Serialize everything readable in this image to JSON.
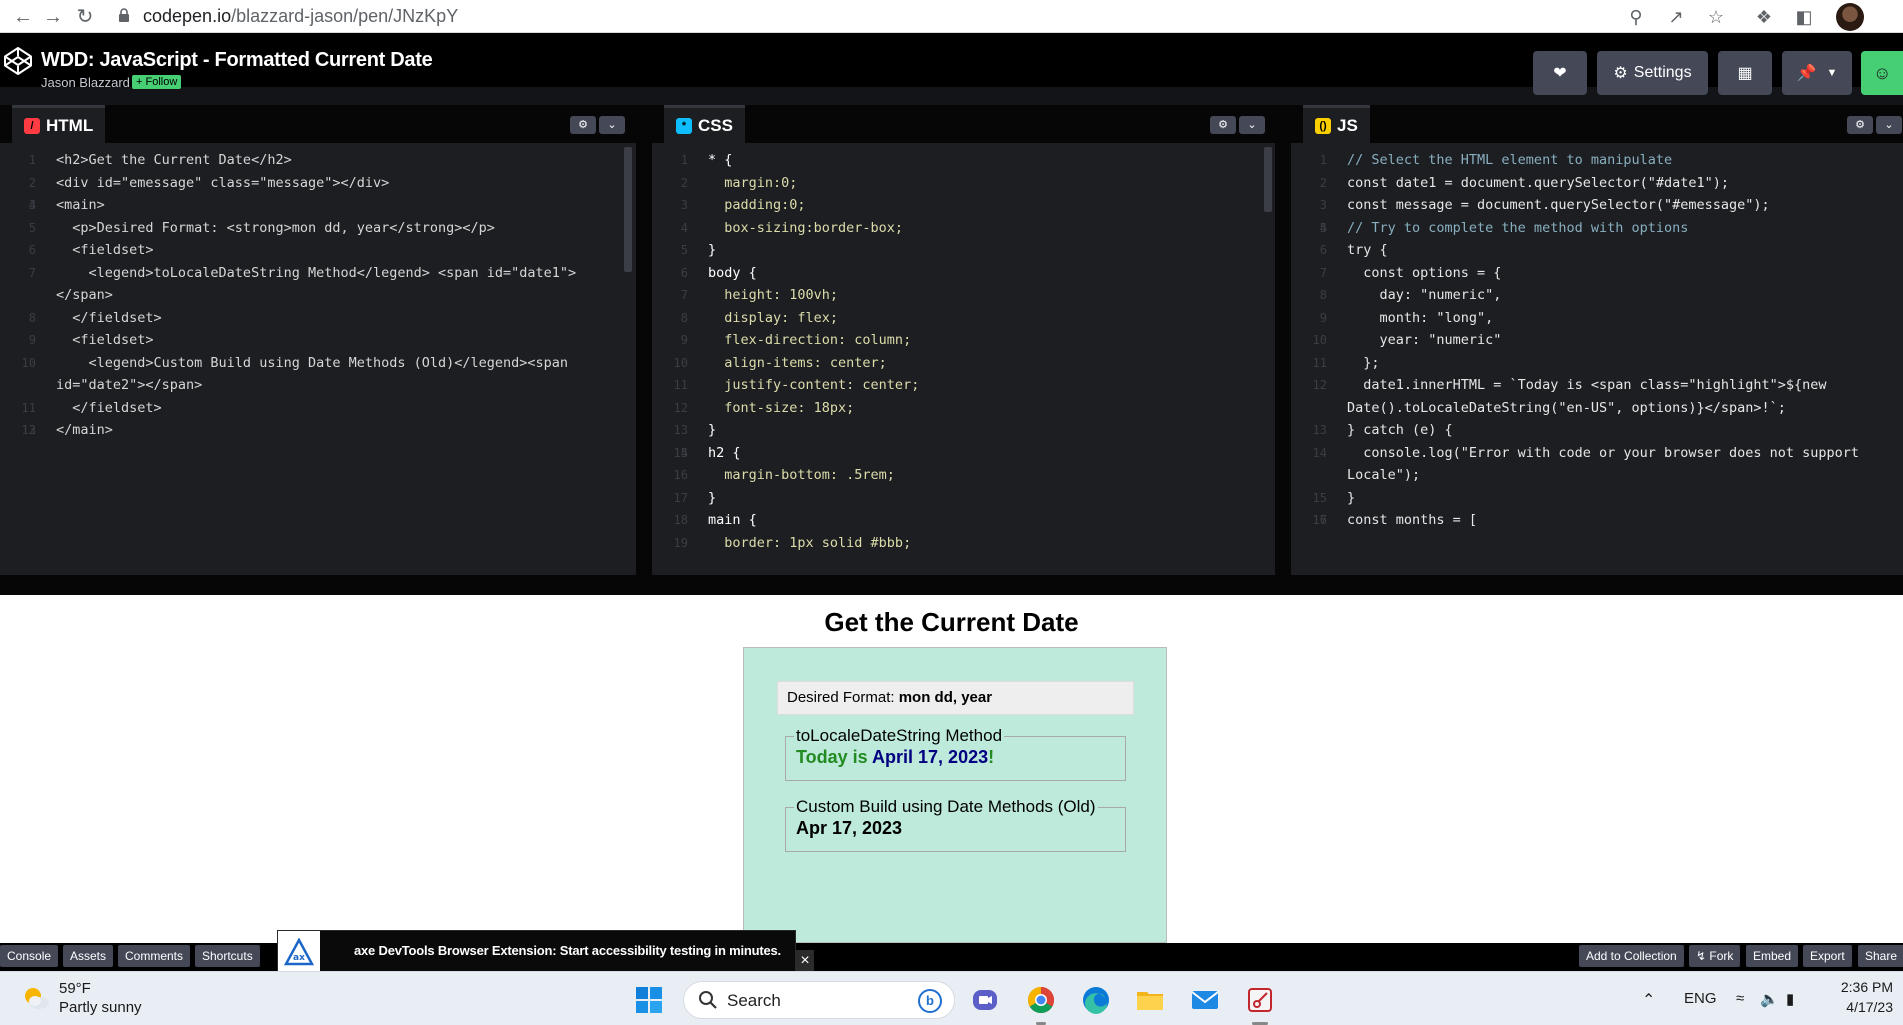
{
  "browser": {
    "url_host": "codepen.io",
    "url_path": "/blazzard-jason/pen/JNzKpY"
  },
  "pen": {
    "title": "WDD: JavaScript - Formatted Current Date",
    "author": "Jason Blazzard",
    "follow_label": "+ Follow",
    "settings_label": "Settings"
  },
  "editors": {
    "html": {
      "label": "HTML",
      "badge_color": "#ff3c41"
    },
    "css": {
      "label": "CSS",
      "badge_color": "#0ebeff"
    },
    "js": {
      "label": "JS",
      "badge_color": "#fcd000"
    }
  },
  "html_code": [
    {
      "n": "1",
      "t": "<h2>Get the Current Date</h2>"
    },
    {
      "n": "2",
      "t": "<div id=\"emessage\" class=\"message\"></div>"
    },
    {
      "n": "3",
      "t": ""
    },
    {
      "n": "4",
      "t": "<main>"
    },
    {
      "n": "5",
      "t": "  <p>Desired Format: <strong>mon dd, year</strong></p>"
    },
    {
      "n": "6",
      "t": "  <fieldset>"
    },
    {
      "n": "7",
      "t": "    <legend>toLocaleDateString Method</legend> <span id=\"date1\">"
    },
    {
      "n": "",
      "t": "</span>"
    },
    {
      "n": "8",
      "t": "  </fieldset>"
    },
    {
      "n": "9",
      "t": "  <fieldset>"
    },
    {
      "n": "10",
      "t": "    <legend>Custom Build using Date Methods (Old)</legend><span"
    },
    {
      "n": "",
      "t": "id=\"date2\"></span>"
    },
    {
      "n": "11",
      "t": "  </fieldset>"
    },
    {
      "n": "12",
      "t": ""
    },
    {
      "n": "13",
      "t": "</main>"
    }
  ],
  "css_code": [
    {
      "n": "1",
      "t": "* {"
    },
    {
      "n": "2",
      "t": "  margin:0;"
    },
    {
      "n": "3",
      "t": "  padding:0;"
    },
    {
      "n": "4",
      "t": "  box-sizing:border-box;"
    },
    {
      "n": "5",
      "t": "}"
    },
    {
      "n": "6",
      "t": "body {"
    },
    {
      "n": "7",
      "t": "  height: 100vh;"
    },
    {
      "n": "8",
      "t": "  display: flex;"
    },
    {
      "n": "9",
      "t": "  flex-direction: column;"
    },
    {
      "n": "10",
      "t": "  align-items: center;"
    },
    {
      "n": "11",
      "t": "  justify-content: center;"
    },
    {
      "n": "12",
      "t": "  font-size: 18px;"
    },
    {
      "n": "13",
      "t": "}"
    },
    {
      "n": "14",
      "t": ""
    },
    {
      "n": "15",
      "t": "h2 {"
    },
    {
      "n": "16",
      "t": "  margin-bottom: .5rem;"
    },
    {
      "n": "17",
      "t": "}"
    },
    {
      "n": "18",
      "t": "main {"
    },
    {
      "n": "19",
      "t": "  border: 1px solid #bbb;"
    }
  ],
  "js_code": [
    {
      "n": "1",
      "t": "// Select the HTML element to manipulate"
    },
    {
      "n": "2",
      "t": "const date1 = document.querySelector(\"#date1\");"
    },
    {
      "n": "3",
      "t": "const message = document.querySelector(\"#emessage\");"
    },
    {
      "n": "4",
      "t": ""
    },
    {
      "n": "5",
      "t": "// Try to complete the method with options"
    },
    {
      "n": "6",
      "t": "try {"
    },
    {
      "n": "7",
      "t": "  const options = {"
    },
    {
      "n": "8",
      "t": "    day: \"numeric\","
    },
    {
      "n": "9",
      "t": "    month: \"long\","
    },
    {
      "n": "10",
      "t": "    year: \"numeric\""
    },
    {
      "n": "11",
      "t": "  };"
    },
    {
      "n": "12",
      "t": "  date1.innerHTML = `Today is <span class=\"highlight\">${new"
    },
    {
      "n": "",
      "t": "Date().toLocaleDateString(\"en-US\", options)}</span>!`;"
    },
    {
      "n": "13",
      "t": "} catch (e) {"
    },
    {
      "n": "14",
      "t": "  console.log(\"Error with code or your browser does not support"
    },
    {
      "n": "",
      "t": "Locale\");"
    },
    {
      "n": "15",
      "t": "}"
    },
    {
      "n": "16",
      "t": ""
    },
    {
      "n": "17",
      "t": "const months = ["
    }
  ],
  "result": {
    "heading": "Get the Current Date",
    "desired_label": "Desired Format: ",
    "desired_value": "mon dd, year",
    "fieldset1_legend": "toLocaleDateString Method",
    "fieldset1_prefix": "Today is ",
    "fieldset1_date": "April 17, 2023",
    "fieldset1_suffix": "!",
    "fieldset2_legend": "Custom Build using Date Methods (Old)",
    "fieldset2_value": "Apr 17, 2023"
  },
  "bottom_bar": {
    "left": [
      "Console",
      "Assets",
      "Comments",
      "Shortcuts"
    ],
    "right": [
      "Add to Collection",
      "Fork",
      "Embed",
      "Export",
      "Share"
    ]
  },
  "axe_toast": {
    "text": "axe DevTools Browser Extension: Start accessibility testing in minutes.",
    "close": "×"
  },
  "taskbar": {
    "temperature": "59°F",
    "weather": "Partly sunny",
    "search_placeholder": "Search",
    "language": "ENG",
    "time": "2:36 PM",
    "date": "4/17/23"
  }
}
